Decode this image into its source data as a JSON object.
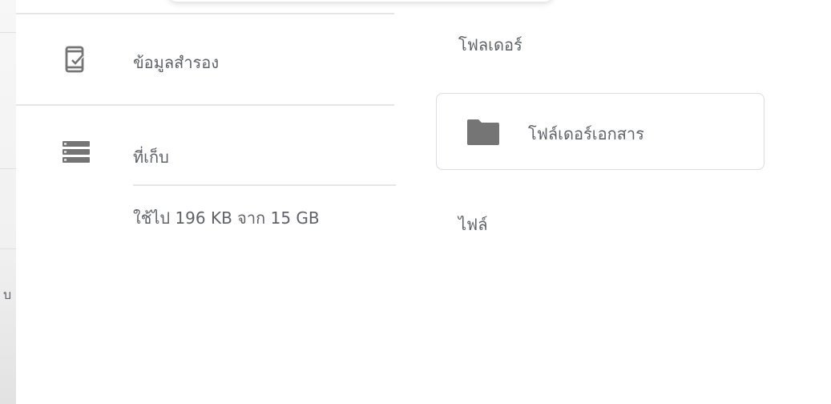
{
  "sidebar": {
    "items": [
      {
        "label": "ข้อมูลสำรอง",
        "icon": "phone-check-icon"
      },
      {
        "label": "ที่เก็บ",
        "icon": "storage-icon"
      }
    ],
    "storage_usage": "ใช้ไป 196 KB จาก 15 GB",
    "background_glyph": "บ"
  },
  "main": {
    "folders_heading": "โฟลเดอร์",
    "folders": [
      {
        "name": "โฟล์เดอร์เอกสาร",
        "icon": "folder-icon"
      }
    ],
    "files_heading": "ไฟล์"
  },
  "colors": {
    "text": "#5f6368",
    "icon": "#757575",
    "divider": "#e6e6e6",
    "card_border": "#dadce0"
  }
}
